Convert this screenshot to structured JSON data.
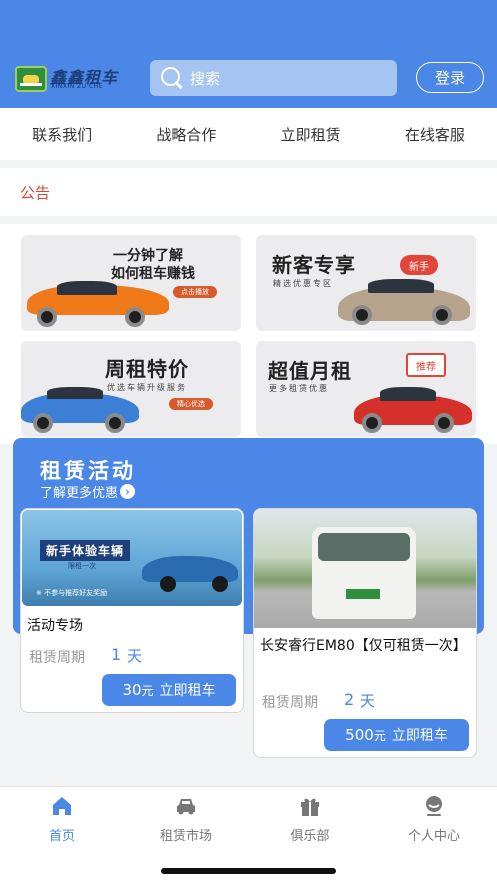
{
  "header": {
    "logo_text": "鑫鑫租车",
    "logo_sub": "XINXIN ZU CHE",
    "search_placeholder": "搜索",
    "login_label": "登录"
  },
  "nav": [
    "联系我们",
    "战略合作",
    "立即租赁",
    "在线客服"
  ],
  "notice": {
    "label": "公告"
  },
  "promos": [
    {
      "title_line1": "一分钟了解",
      "title_line2": "如何租车赚钱",
      "tag": "点击播放"
    },
    {
      "title": "新客专享",
      "sub": "精选优惠专区",
      "badge": "新手"
    },
    {
      "title": "周租特价",
      "sub": "优选车辆升级服务",
      "tag": "精心优选"
    },
    {
      "title": "超值月租",
      "sub": "更多租赁优惠",
      "badge": "推荐"
    }
  ],
  "activity": {
    "title": "租赁活动",
    "subtitle": "了解更多优惠",
    "cards": [
      {
        "banner_title": "新手体验车辆",
        "banner_sub": "限租一次",
        "banner_note": "※ 不参与推荐好友奖励",
        "name": "活动专场",
        "period_label": "租赁周期",
        "period_value": "1",
        "period_unit": "天",
        "price": "30",
        "price_unit": "元",
        "button_label": "立即租车"
      },
      {
        "name": "长安睿行EM80【仅可租赁一次】",
        "period_label": "租赁周期",
        "period_value": "2",
        "period_unit": "天",
        "price": "500",
        "price_unit": "元",
        "button_label": "立即租车"
      }
    ]
  },
  "tabbar": [
    "首页",
    "租赁市场",
    "俱乐部",
    "个人中心"
  ],
  "colors": {
    "primary": "#4a87e6",
    "notice": "#d9493a",
    "tag": "#d65a2b"
  }
}
